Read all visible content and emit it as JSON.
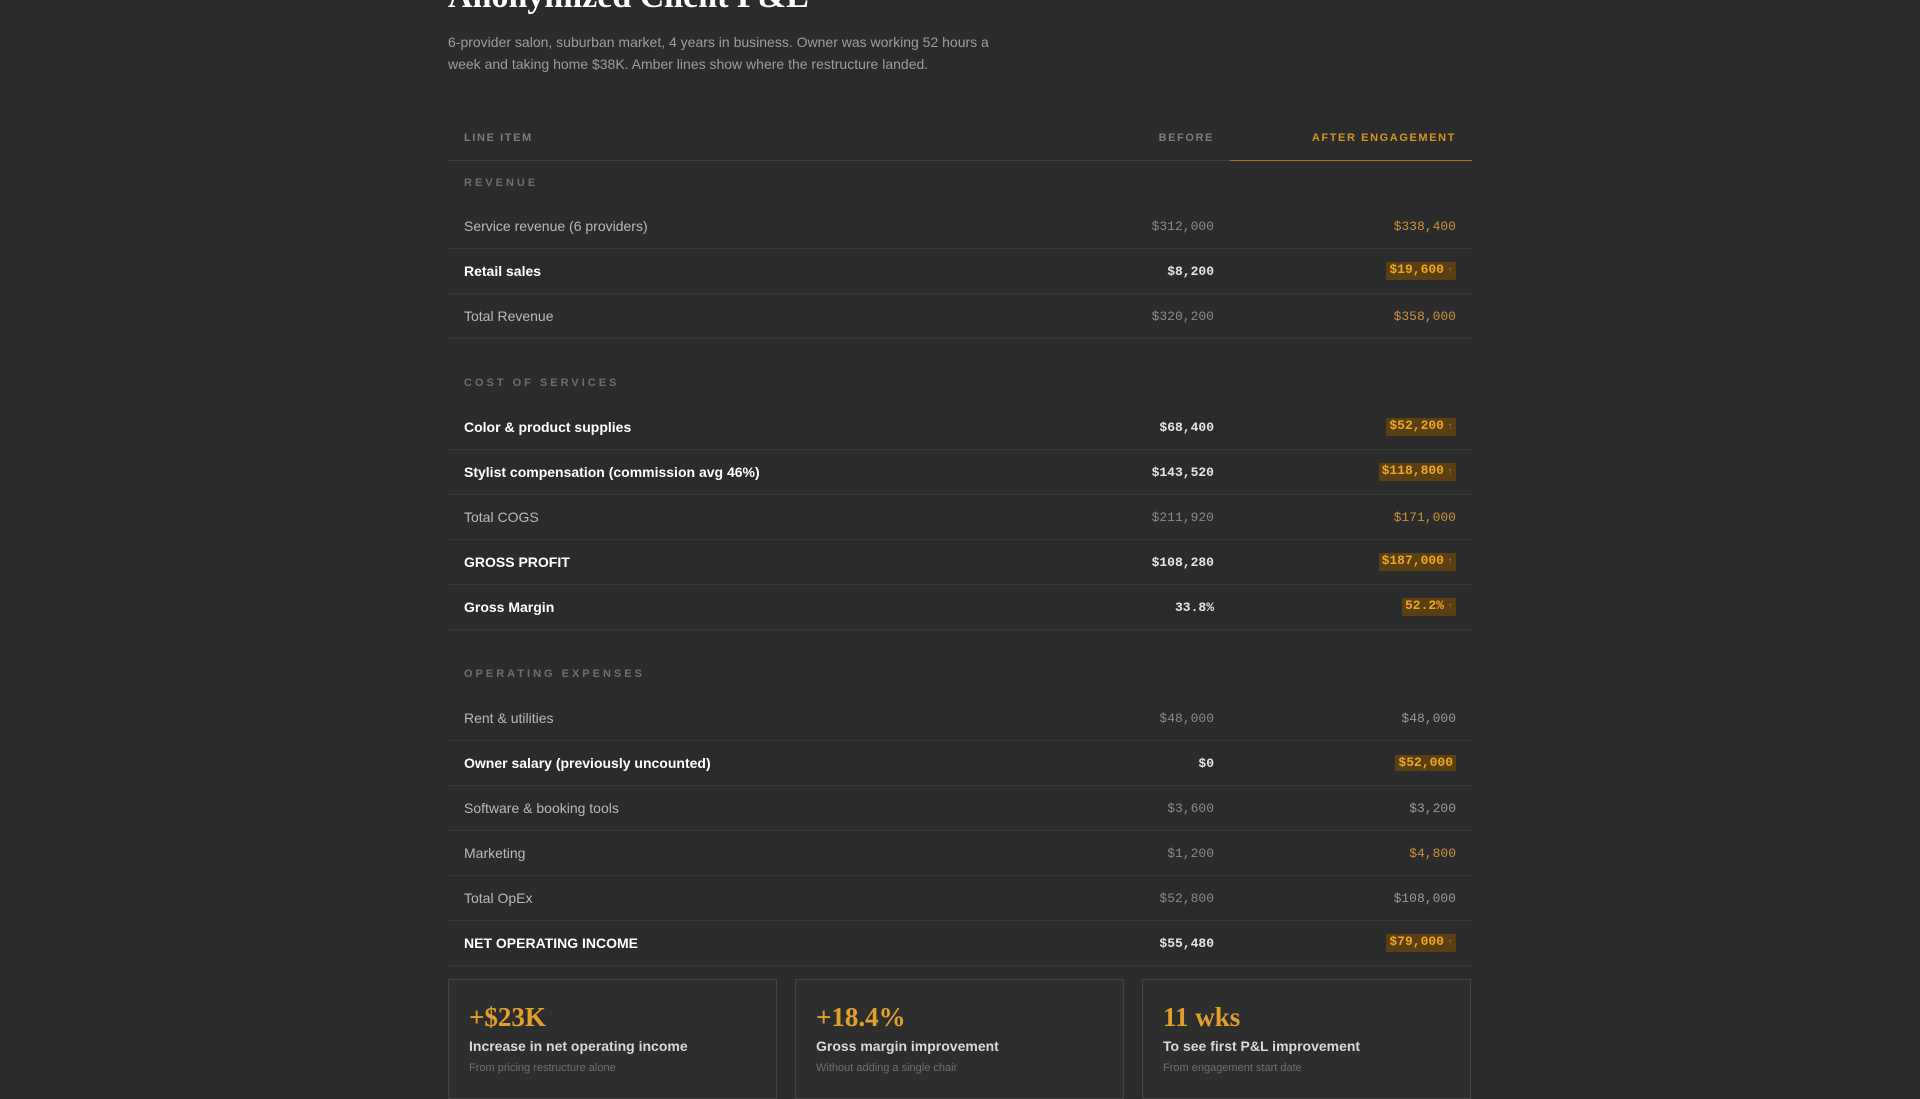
{
  "header": {
    "title": "Anonymized Client P&L",
    "subtitle": "6-provider salon, suburban market, 4 years in business. Owner was working 52 hours a week and taking home $38K. Amber lines show where the restructure landed."
  },
  "table": {
    "col_item": "Line Item",
    "col_before": "Before",
    "col_after": "After Engagement",
    "sections": {
      "revenue": "REVENUE",
      "cogs": "COST OF SERVICES",
      "opex": "OPERATING EXPENSES"
    },
    "rows": [
      {
        "item": "Service revenue (6 providers)",
        "before": "$312,000",
        "after": "$338,400"
      },
      {
        "item": "Retail sales",
        "before": "$8,200",
        "after": "$19,600"
      },
      {
        "item": "Total Revenue",
        "before": "$320,200",
        "after": "$358,000"
      },
      {
        "item": "Color & product supplies",
        "before": "$68,400",
        "after": "$52,200"
      },
      {
        "item": "Stylist compensation (commission avg 46%)",
        "before": "$143,520",
        "after": "$118,800"
      },
      {
        "item": "Total COGS",
        "before": "$211,920",
        "after": "$171,000"
      },
      {
        "item": "GROSS PROFIT",
        "before": "$108,280",
        "after": "$187,000"
      },
      {
        "item": "Gross Margin",
        "before": "33.8%",
        "after": "52.2%"
      },
      {
        "item": "Rent & utilities",
        "before": "$48,000",
        "after": "$48,000"
      },
      {
        "item": "Owner salary (previously uncounted)",
        "before": "$0",
        "after": "$52,000"
      },
      {
        "item": "Software & booking tools",
        "before": "$3,600",
        "after": "$3,200"
      },
      {
        "item": "Marketing",
        "before": "$1,200",
        "after": "$4,800"
      },
      {
        "item": "Total OpEx",
        "before": "$52,800",
        "after": "$108,000"
      },
      {
        "item": "NET OPERATING INCOME",
        "before": "$55,480",
        "after": "$79,000"
      }
    ],
    "up_arrow": "↑"
  },
  "cards": [
    {
      "value": "+$23K",
      "label": "Increase in net operating income",
      "note": "From pricing restructure alone"
    },
    {
      "value": "+18.4%",
      "label": "Gross margin improvement",
      "note": "Without adding a single chair"
    },
    {
      "value": "11 wks",
      "label": "To see first P&L improvement",
      "note": "From engagement start date"
    }
  ],
  "colors": {
    "background": "#2b2b2b",
    "accent": "#e0a02a",
    "highlight_bg": "#5a3f12"
  }
}
